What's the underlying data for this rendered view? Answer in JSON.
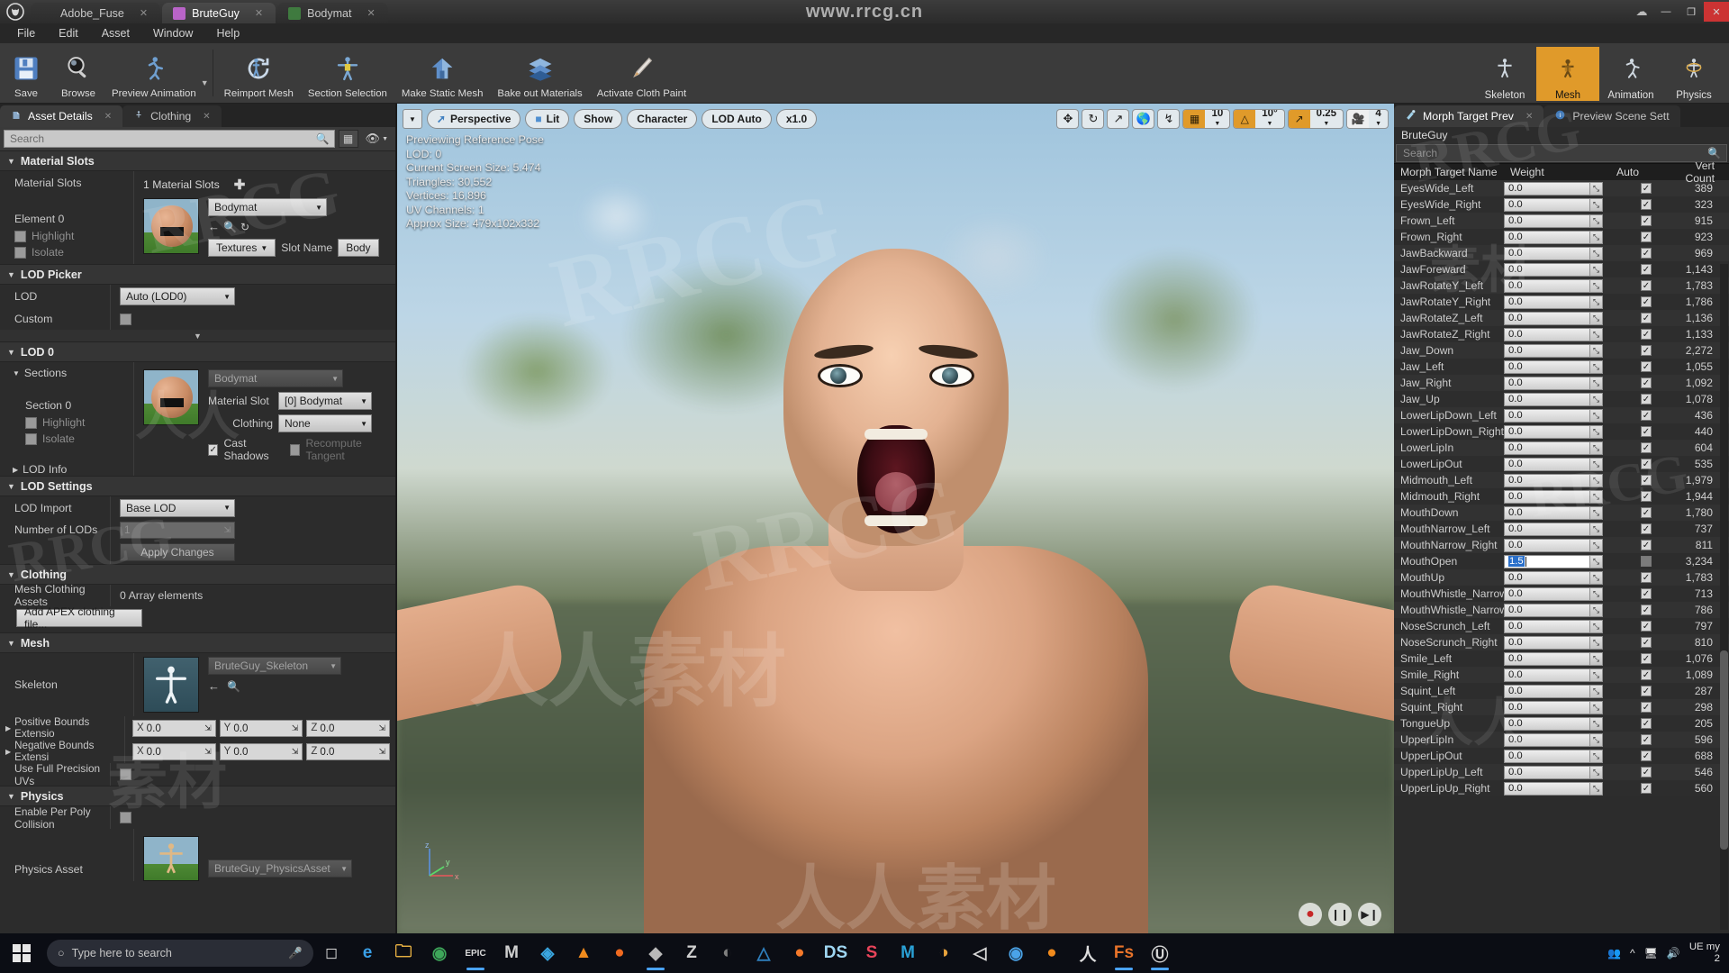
{
  "window": {
    "app_tabs": [
      {
        "label": "Adobe_Fuse",
        "icon": "ue-logo-icon",
        "active": false
      },
      {
        "label": "BruteGuy",
        "icon": "skeletal-mesh-icon",
        "active": true
      },
      {
        "label": "Bodymat",
        "icon": "material-icon",
        "active": false
      }
    ],
    "watermark": "www.rrcg.cn",
    "controls": {
      "minimize": "—",
      "maximize": "❐",
      "close": "✕",
      "cloud": "☁"
    }
  },
  "menu": {
    "items": [
      "File",
      "Edit",
      "Asset",
      "Window",
      "Help"
    ]
  },
  "toolbar": {
    "buttons": [
      {
        "label": "Save",
        "icon": "save-disk-icon"
      },
      {
        "label": "Browse",
        "icon": "magnifier-browse-icon"
      },
      {
        "label": "Preview Animation",
        "icon": "running-character-icon",
        "has_caret": true
      },
      {
        "label": "Reimport Mesh",
        "icon": "reimport-arrow-icon"
      },
      {
        "label": "Section Selection",
        "icon": "tpose-character-icon"
      },
      {
        "label": "Make Static Mesh",
        "icon": "house-mesh-icon"
      },
      {
        "label": "Bake out Materials",
        "icon": "layers-stack-icon"
      },
      {
        "label": "Activate Cloth Paint",
        "icon": "paintbrush-icon"
      }
    ],
    "modes": [
      {
        "label": "Skeleton",
        "icon": "skeleton-mode-icon",
        "selected": false
      },
      {
        "label": "Mesh",
        "icon": "mesh-mode-icon",
        "selected": true
      },
      {
        "label": "Animation",
        "icon": "animation-mode-icon",
        "selected": false
      },
      {
        "label": "Physics",
        "icon": "physics-mode-icon",
        "selected": false
      }
    ]
  },
  "left_panel": {
    "tabs": [
      {
        "label": "Asset Details",
        "icon": "asset-details-icon",
        "active": true
      },
      {
        "label": "Clothing",
        "icon": "clothing-icon",
        "active": false
      }
    ],
    "search_placeholder": "Search",
    "sections": {
      "material_slots": {
        "title": "Material Slots",
        "label": "Material Slots",
        "count_text": "1 Material Slots",
        "add_icon": "plus-icon",
        "element_label": "Element 0",
        "highlight_label": "Highlight",
        "isolate_label": "Isolate",
        "material_value": "Bodymat",
        "textures_button": "Textures",
        "slot_name_label": "Slot Name",
        "slot_name_value": "Body"
      },
      "lod_picker": {
        "title": "LOD Picker",
        "lod_label": "LOD",
        "lod_value": "Auto (LOD0)",
        "custom_label": "Custom"
      },
      "lod0": {
        "title": "LOD 0",
        "sections_label": "Sections",
        "section_label": "Section 0",
        "highlight_label": "Highlight",
        "isolate_label": "Isolate",
        "material_name": "Bodymat",
        "material_slot_label": "Material Slot",
        "material_slot_value": "[0] Bodymat",
        "clothing_label": "Clothing",
        "clothing_value": "None",
        "cast_shadows_label": "Cast Shadows",
        "recompute_label": "Recompute Tangent",
        "lod_info_label": "LOD Info"
      },
      "lod_settings": {
        "title": "LOD Settings",
        "lod_import_label": "LOD Import",
        "lod_import_value": "Base LOD",
        "number_label": "Number of LODs",
        "number_value": "1",
        "apply_button": "Apply Changes"
      },
      "clothing": {
        "title": "Clothing",
        "assets_label": "Mesh Clothing Assets",
        "assets_value": "0 Array elements",
        "add_button": "Add APEX clothing file..."
      },
      "mesh": {
        "title": "Mesh",
        "skeleton_label": "Skeleton",
        "skeleton_value": "BruteGuy_Skeleton",
        "pos_bounds_label": "Positive Bounds Extensio",
        "neg_bounds_label": "Negative Bounds Extensi",
        "axes": [
          "X",
          "Y",
          "Z"
        ],
        "bounds_value": "0.0",
        "full_precision_label": "Use Full Precision UVs"
      },
      "physics": {
        "title": "Physics",
        "per_poly_label": "Enable Per Poly Collision",
        "physics_asset_label": "Physics Asset",
        "physics_asset_value": "BruteGuy_PhysicsAsset"
      }
    }
  },
  "viewport": {
    "toolbar": {
      "menu_caret": "▼",
      "perspective": "Perspective",
      "lit": "Lit",
      "show": "Show",
      "character": "Character",
      "lod": "LOD Auto",
      "speed": "x1.0",
      "icons": [
        "translate-icon",
        "rotate-icon",
        "scale-icon",
        "world-space-icon",
        "surface-snap-icon"
      ],
      "grid_snap": "10",
      "angle_snap": "10°",
      "scale_snap": "0.25",
      "camera_speed": "4"
    },
    "stats": [
      "Previewing Reference Pose",
      "LOD: 0",
      "Current Screen Size: 5.474",
      "Triangles: 30,552",
      "Vertices: 16,896",
      "UV Channels: 1",
      "Approx Size: 479x102x332"
    ],
    "gizmo": {
      "z": "z",
      "y": "y",
      "x": "x"
    },
    "playback": [
      {
        "icon": "record-icon",
        "name": "record-button"
      },
      {
        "icon": "pause-icon",
        "name": "pause-button"
      },
      {
        "icon": "step-icon",
        "name": "step-forward-button"
      }
    ]
  },
  "right_panel": {
    "tabs": [
      {
        "label": "Morph Target Prev",
        "icon": "morph-target-icon",
        "active": true
      },
      {
        "label": "Preview Scene Sett",
        "icon": "preview-scene-icon",
        "active": false
      }
    ],
    "asset_name": "BruteGuy",
    "search_placeholder": "Search",
    "columns": [
      "Morph Target Name",
      "Weight",
      "Auto",
      "Vert Count"
    ],
    "rows": [
      {
        "name": "EyesWide_Left",
        "weight": "0.0",
        "auto": true,
        "vert": "389"
      },
      {
        "name": "EyesWide_Right",
        "weight": "0.0",
        "auto": true,
        "vert": "323"
      },
      {
        "name": "Frown_Left",
        "weight": "0.0",
        "auto": true,
        "vert": "915"
      },
      {
        "name": "Frown_Right",
        "weight": "0.0",
        "auto": true,
        "vert": "923"
      },
      {
        "name": "JawBackward",
        "weight": "0.0",
        "auto": true,
        "vert": "969"
      },
      {
        "name": "JawForeward",
        "weight": "0.0",
        "auto": true,
        "vert": "1,143"
      },
      {
        "name": "JawRotateY_Left",
        "weight": "0.0",
        "auto": true,
        "vert": "1,783"
      },
      {
        "name": "JawRotateY_Right",
        "weight": "0.0",
        "auto": true,
        "vert": "1,786"
      },
      {
        "name": "JawRotateZ_Left",
        "weight": "0.0",
        "auto": true,
        "vert": "1,136"
      },
      {
        "name": "JawRotateZ_Right",
        "weight": "0.0",
        "auto": true,
        "vert": "1,133"
      },
      {
        "name": "Jaw_Down",
        "weight": "0.0",
        "auto": true,
        "vert": "2,272"
      },
      {
        "name": "Jaw_Left",
        "weight": "0.0",
        "auto": true,
        "vert": "1,055"
      },
      {
        "name": "Jaw_Right",
        "weight": "0.0",
        "auto": true,
        "vert": "1,092"
      },
      {
        "name": "Jaw_Up",
        "weight": "0.0",
        "auto": true,
        "vert": "1,078"
      },
      {
        "name": "LowerLipDown_Left",
        "weight": "0.0",
        "auto": true,
        "vert": "436"
      },
      {
        "name": "LowerLipDown_Right",
        "weight": "0.0",
        "auto": true,
        "vert": "440"
      },
      {
        "name": "LowerLipIn",
        "weight": "0.0",
        "auto": true,
        "vert": "604"
      },
      {
        "name": "LowerLipOut",
        "weight": "0.0",
        "auto": true,
        "vert": "535"
      },
      {
        "name": "Midmouth_Left",
        "weight": "0.0",
        "auto": true,
        "vert": "1,979"
      },
      {
        "name": "Midmouth_Right",
        "weight": "0.0",
        "auto": true,
        "vert": "1,944"
      },
      {
        "name": "MouthDown",
        "weight": "0.0",
        "auto": true,
        "vert": "1,780"
      },
      {
        "name": "MouthNarrow_Left",
        "weight": "0.0",
        "auto": true,
        "vert": "737"
      },
      {
        "name": "MouthNarrow_Right",
        "weight": "0.0",
        "auto": true,
        "vert": "811"
      },
      {
        "name": "MouthOpen",
        "weight": "1.5",
        "auto": false,
        "vert": "3,234",
        "editing": true
      },
      {
        "name": "MouthUp",
        "weight": "0.0",
        "auto": true,
        "vert": "1,783"
      },
      {
        "name": "MouthWhistle_NarrowAdjust_Left",
        "weight": "0.0",
        "auto": true,
        "vert": "713"
      },
      {
        "name": "MouthWhistle_NarrowAdjust_Right",
        "weight": "0.0",
        "auto": true,
        "vert": "786"
      },
      {
        "name": "NoseScrunch_Left",
        "weight": "0.0",
        "auto": true,
        "vert": "797"
      },
      {
        "name": "NoseScrunch_Right",
        "weight": "0.0",
        "auto": true,
        "vert": "810"
      },
      {
        "name": "Smile_Left",
        "weight": "0.0",
        "auto": true,
        "vert": "1,076"
      },
      {
        "name": "Smile_Right",
        "weight": "0.0",
        "auto": true,
        "vert": "1,089"
      },
      {
        "name": "Squint_Left",
        "weight": "0.0",
        "auto": true,
        "vert": "287"
      },
      {
        "name": "Squint_Right",
        "weight": "0.0",
        "auto": true,
        "vert": "298"
      },
      {
        "name": "TongueUp",
        "weight": "0.0",
        "auto": true,
        "vert": "205"
      },
      {
        "name": "UpperLipIn",
        "weight": "0.0",
        "auto": true,
        "vert": "596"
      },
      {
        "name": "UpperLipOut",
        "weight": "0.0",
        "auto": true,
        "vert": "688"
      },
      {
        "name": "UpperLipUp_Left",
        "weight": "0.0",
        "auto": true,
        "vert": "546"
      },
      {
        "name": "UpperLipUp_Right",
        "weight": "0.0",
        "auto": true,
        "vert": "560"
      }
    ]
  },
  "taskbar": {
    "start_icon": "windows-start-icon",
    "search_placeholder": "Type here to search",
    "search_icon": "search-icon",
    "mic_icon": "microphone-icon",
    "taskview_icon": "task-view-icon",
    "apps": [
      {
        "icon": "edge-icon",
        "glyph": "e",
        "color": "#3aa0e8",
        "active": false
      },
      {
        "icon": "file-explorer-icon",
        "glyph": "🗀",
        "color": "#ffc247",
        "active": false
      },
      {
        "icon": "chrome-icon",
        "glyph": "◉",
        "color": "#3ea65a",
        "active": false
      },
      {
        "icon": "epic-games-icon",
        "glyph": "EPIC",
        "color": "#d8d8d8",
        "active": true
      },
      {
        "icon": "designer-icon",
        "glyph": "M",
        "color": "#cfcfcf",
        "active": false
      },
      {
        "icon": "photoshop-icon",
        "glyph": "◈",
        "color": "#3aa6e0",
        "active": false
      },
      {
        "icon": "vlc-icon",
        "glyph": "▲",
        "color": "#f08a1d",
        "active": false
      },
      {
        "icon": "firefox-alt-icon",
        "glyph": "●",
        "color": "#f06a20",
        "active": false
      },
      {
        "icon": "unreal-project-icon",
        "glyph": "◆",
        "color": "#b9b9b9",
        "active": true
      },
      {
        "icon": "zbrush-icon",
        "glyph": "Z",
        "color": "#cfcfcf",
        "active": false
      },
      {
        "icon": "quixel-icon",
        "glyph": "◐",
        "color": "#7f7f7f",
        "active": false
      },
      {
        "icon": "3dsmax-icon",
        "glyph": "△",
        "color": "#2f7fbd",
        "active": false
      },
      {
        "icon": "blender-icon",
        "glyph": "●",
        "color": "#f5792a",
        "active": false
      },
      {
        "icon": "daz-icon",
        "glyph": "DS",
        "color": "#9fd6f2",
        "active": false
      },
      {
        "icon": "substance-icon",
        "glyph": "S",
        "color": "#e8445a",
        "active": false
      },
      {
        "icon": "marmoset-icon",
        "glyph": "M",
        "color": "#2aa1d6",
        "active": false
      },
      {
        "icon": "maya-icon",
        "glyph": "◑",
        "color": "#e8a33d",
        "active": false
      },
      {
        "icon": "unity-icon",
        "glyph": "◁",
        "color": "#d8d8d8",
        "active": false
      },
      {
        "icon": "krita-icon",
        "glyph": "◉",
        "color": "#4aa3e8",
        "active": false
      },
      {
        "icon": "firefox-icon",
        "glyph": "●",
        "color": "#f08a1d",
        "active": false
      },
      {
        "icon": "mixamo-icon",
        "glyph": "人",
        "color": "#dedede",
        "active": false
      },
      {
        "icon": "fuse-icon",
        "glyph": "Fs",
        "color": "#e8732a",
        "active": true
      },
      {
        "icon": "unreal-engine-icon",
        "glyph": "Ⓤ",
        "color": "#d5d5d5",
        "active": true
      }
    ],
    "tray": {
      "people_icon": "people-icon",
      "chevron_icon": "show-hidden-icon",
      "network_icon": "network-icon",
      "volume_icon": "volume-icon",
      "time": "UE my",
      "date": "2"
    }
  }
}
